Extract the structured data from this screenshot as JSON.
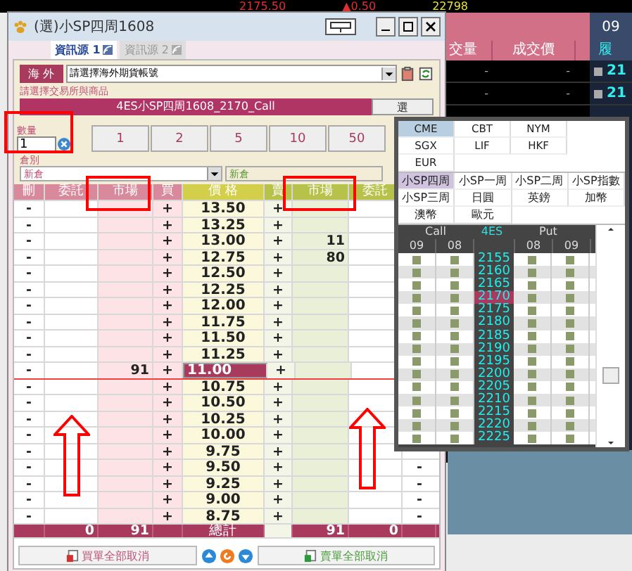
{
  "background_app": {
    "ticker": [
      {
        "text": "2175.50",
        "kind": "price"
      },
      {
        "text": "▲0.50",
        "kind": "change"
      },
      {
        "text": "22798",
        "kind": "volume"
      }
    ],
    "columns": [
      "交量",
      "成交價"
    ],
    "side_header": "09",
    "side_column": "履",
    "rows": [
      {
        "cells": [
          "-",
          "-"
        ],
        "value": "21"
      },
      {
        "cells": [
          "-",
          "-"
        ],
        "value": "21"
      }
    ]
  },
  "window": {
    "title": "(選)小SP四周1608"
  },
  "tabs": [
    {
      "label": "資訊源 1",
      "selected": true
    },
    {
      "label": "資訊源 2",
      "selected": false
    }
  ],
  "account": {
    "label": "海 外",
    "value": "請選擇海外期貨帳號"
  },
  "product_group": {
    "legend": "請選擇交易所與商品",
    "product": "4ES小SP四周1608_2170_Call",
    "pick_button": "選"
  },
  "quantity": {
    "label": "數量",
    "value": "1",
    "presets": [
      "1",
      "2",
      "5",
      "10",
      "50"
    ]
  },
  "position": {
    "label": "倉別",
    "value": "新倉",
    "echo": "新倉"
  },
  "ladder": {
    "columns": [
      "刪",
      "委託",
      "市場",
      "買",
      "價 格",
      "賣",
      "市場",
      "委託"
    ],
    "rows": [
      {
        "cancel": "-",
        "buy": "+",
        "price": "13.50",
        "sell": "+",
        "selected": false
      },
      {
        "cancel": "-",
        "buy": "+",
        "price": "13.25",
        "sell": "+",
        "selected": false
      },
      {
        "cancel": "-",
        "buy": "+",
        "price": "13.00",
        "sell": "+",
        "sell_market": "11",
        "selected": false
      },
      {
        "cancel": "-",
        "buy": "+",
        "price": "12.75",
        "sell": "+",
        "sell_market": "80",
        "selected": false
      },
      {
        "cancel": "-",
        "buy": "+",
        "price": "12.50",
        "sell": "+",
        "selected": false
      },
      {
        "cancel": "-",
        "buy": "+",
        "price": "12.25",
        "sell": "+",
        "selected": false
      },
      {
        "cancel": "-",
        "buy": "+",
        "price": "12.00",
        "sell": "+",
        "selected": false
      },
      {
        "cancel": "-",
        "buy": "+",
        "price": "11.75",
        "sell": "+",
        "selected": false
      },
      {
        "cancel": "-",
        "buy": "+",
        "price": "11.50",
        "sell": "+",
        "selected": false
      },
      {
        "cancel": "-",
        "buy": "+",
        "price": "11.25",
        "sell": "+",
        "selected": false
      },
      {
        "cancel": "-",
        "buy_market": "91",
        "buy": "+",
        "price": "11.00",
        "sell": "+",
        "selected": true
      },
      {
        "cancel": "-",
        "buy": "+",
        "price": "10.75",
        "sell": "+",
        "selected": false
      },
      {
        "cancel": "-",
        "buy": "+",
        "price": "10.50",
        "sell": "+",
        "selected": false
      },
      {
        "cancel": "-",
        "buy": "+",
        "price": "10.25",
        "sell": "+",
        "selected": false
      },
      {
        "cancel": "-",
        "buy": "+",
        "price": "10.00",
        "sell": "+",
        "selected": false
      },
      {
        "cancel": "-",
        "buy": "+",
        "price": "9.75",
        "sell": "+",
        "selected": false
      },
      {
        "cancel": "-",
        "buy": "+",
        "price": "9.50",
        "sell": "+",
        "right_cancel": "-",
        "selected": false
      },
      {
        "cancel": "-",
        "buy": "+",
        "price": "9.25",
        "sell": "+",
        "right_cancel": "-",
        "selected": false
      },
      {
        "cancel": "-",
        "buy": "+",
        "price": "9.00",
        "sell": "+",
        "right_cancel": "-",
        "selected": false
      },
      {
        "cancel": "-",
        "buy": "+",
        "price": "8.75",
        "sell": "+",
        "right_cancel": "-",
        "selected": false
      }
    ],
    "totals": {
      "buy_orders": "0",
      "buy_market": "91",
      "label": "總計",
      "sell_market": "91",
      "sell_orders": "0"
    }
  },
  "footer": {
    "cancel_buys": "買單全部取消",
    "cancel_sells": "賣單全部取消"
  },
  "popup": {
    "exchanges": [
      {
        "label": "CME",
        "selected": true
      },
      {
        "label": "CBT",
        "selected": false
      },
      {
        "label": "NYM",
        "selected": false
      },
      {
        "label": "SGX",
        "selected": false
      },
      {
        "label": "LIF",
        "selected": false
      },
      {
        "label": "HKF",
        "selected": false
      },
      {
        "label": "EUR",
        "selected": false
      }
    ],
    "products": [
      {
        "label": "小SP四周",
        "selected": true
      },
      {
        "label": "小SP一周",
        "selected": false
      },
      {
        "label": "小SP二周",
        "selected": false
      },
      {
        "label": "小SP指數",
        "selected": false
      },
      {
        "label": "小SP三周",
        "selected": false
      },
      {
        "label": "日圓",
        "selected": false
      },
      {
        "label": "英鎊",
        "selected": false
      },
      {
        "label": "加幣",
        "selected": false
      },
      {
        "label": "澳幣",
        "selected": false
      },
      {
        "label": "歐元",
        "selected": false
      }
    ],
    "chain": {
      "call": "Call",
      "underlying": "4ES",
      "put": "Put",
      "call_months": [
        "09",
        "08"
      ],
      "put_months": [
        "08",
        "09"
      ],
      "strikes": [
        {
          "strike": "2155",
          "selected": false
        },
        {
          "strike": "2160",
          "selected": false
        },
        {
          "strike": "2165",
          "selected": false
        },
        {
          "strike": "2170",
          "selected": true
        },
        {
          "strike": "2175",
          "selected": false
        },
        {
          "strike": "2180",
          "selected": false
        },
        {
          "strike": "2185",
          "selected": false
        },
        {
          "strike": "2190",
          "selected": false
        },
        {
          "strike": "2195",
          "selected": false
        },
        {
          "strike": "2200",
          "selected": false
        },
        {
          "strike": "2205",
          "selected": false
        },
        {
          "strike": "2210",
          "selected": false
        },
        {
          "strike": "2215",
          "selected": false
        },
        {
          "strike": "2220",
          "selected": false
        },
        {
          "strike": "2225",
          "selected": false
        }
      ]
    }
  }
}
